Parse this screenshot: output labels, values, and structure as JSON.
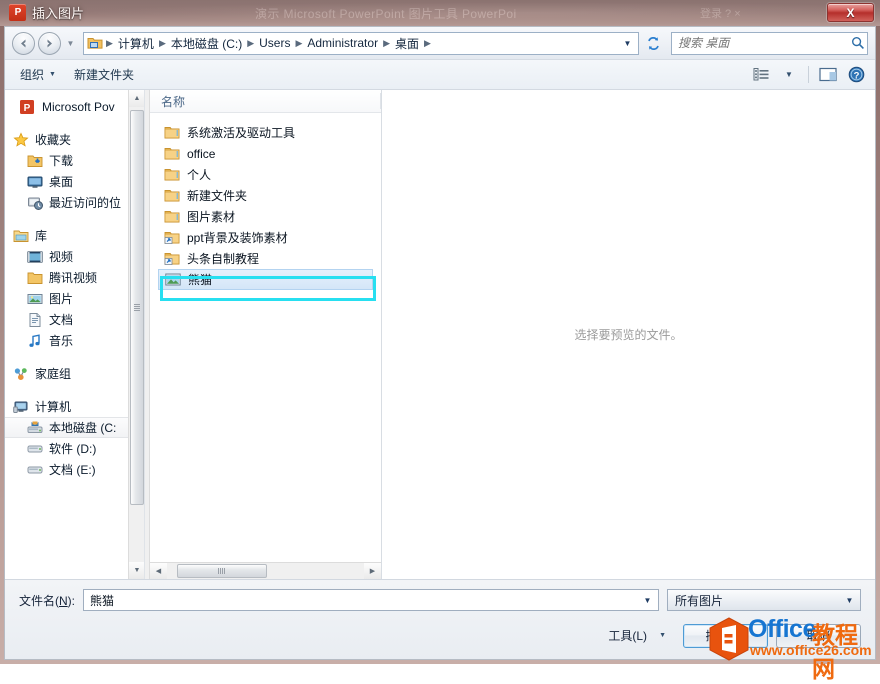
{
  "window": {
    "title": "插入图片",
    "ghost_title": "演示 Microsoft PowerPoint 图片工具  PowerPoi",
    "ghost_right": "登录  ?  ×",
    "close_label": "X",
    "app_icon": "powerpoint-icon"
  },
  "address": {
    "back_icon": "back-arrow-icon",
    "forward_icon": "forward-arrow-icon",
    "history_icon": "chevron-down-icon",
    "folder_icon": "folder-icon",
    "breadcrumbs": [
      "计算机",
      "本地磁盘 (C:)",
      "Users",
      "Administrator",
      "桌面"
    ],
    "separator": "▶",
    "dropdown_icon": "chevron-down-icon",
    "refresh_icon": "refresh-icon",
    "search_placeholder": "搜索 桌面",
    "search_value": "",
    "search_icon": "search-icon"
  },
  "toolbar": {
    "organize_label": "组织",
    "organize_caret": "▼",
    "new_folder_label": "新建文件夹",
    "views_icon": "list-view-icon",
    "views_caret": "▼",
    "preview_pane_icon": "preview-pane-icon",
    "help_icon": "help-icon"
  },
  "sidebar": {
    "app_item": "Microsoft Pov",
    "groups": [
      {
        "label": "收藏夹",
        "icon": "star-icon",
        "items": [
          {
            "label": "下载",
            "icon": "download-folder-icon"
          },
          {
            "label": "桌面",
            "icon": "desktop-icon"
          },
          {
            "label": "最近访问的位",
            "icon": "recent-places-icon"
          }
        ]
      },
      {
        "label": "库",
        "icon": "library-icon",
        "items": [
          {
            "label": "视频",
            "icon": "video-icon"
          },
          {
            "label": "腾讯视频",
            "icon": "folder-icon"
          },
          {
            "label": "图片",
            "icon": "pictures-icon"
          },
          {
            "label": "文档",
            "icon": "documents-icon"
          },
          {
            "label": "音乐",
            "icon": "music-icon"
          }
        ]
      },
      {
        "label": "家庭组",
        "icon": "homegroup-icon",
        "items": []
      },
      {
        "label": "计算机",
        "icon": "computer-icon",
        "items": [
          {
            "label": "本地磁盘 (C:",
            "icon": "system-drive-icon",
            "selected": true
          },
          {
            "label": "软件 (D:)",
            "icon": "drive-icon"
          },
          {
            "label": "文档 (E:)",
            "icon": "drive-icon"
          }
        ]
      }
    ]
  },
  "filelist": {
    "column_header": "名称",
    "rows": [
      {
        "name": "系统激活及驱动工具",
        "icon": "folder-icon",
        "selected": false
      },
      {
        "name": "office",
        "icon": "folder-icon",
        "selected": false
      },
      {
        "name": "个人",
        "icon": "folder-icon",
        "selected": false
      },
      {
        "name": "新建文件夹",
        "icon": "folder-icon",
        "selected": false
      },
      {
        "name": "图片素材",
        "icon": "folder-icon",
        "selected": false
      },
      {
        "name": "ppt背景及装饰素材",
        "icon": "folder-shortcut-icon",
        "selected": false
      },
      {
        "name": "头条自制教程",
        "icon": "folder-shortcut-icon",
        "selected": false
      },
      {
        "name": "熊猫",
        "icon": "image-file-icon",
        "selected": true
      }
    ],
    "scroll_left_icon": "arrow-left-icon",
    "scroll_right_icon": "arrow-right-icon"
  },
  "preview": {
    "empty_text": "选择要预览的文件。"
  },
  "bottom": {
    "filename_label": "文件名(N):",
    "filename_value": "熊猫",
    "filename_dropdown_icon": "chevron-down-icon",
    "filter_value": "所有图片",
    "filter_dropdown_icon": "chevron-down-icon",
    "tools_label": "工具(L)",
    "tools_caret": "▼",
    "insert_label": "插入(S)",
    "cancel_label": "取消"
  },
  "watermark": {
    "brand": "Office",
    "brand_cn": "教程网",
    "url": "www.office26.com",
    "logo_icon": "office-hexagon-logo"
  },
  "colors": {
    "selection_ring": "#27dff0",
    "accent_blue": "#1675d1",
    "accent_orange": "#ef6a10",
    "close_red": "#b52f2b"
  }
}
